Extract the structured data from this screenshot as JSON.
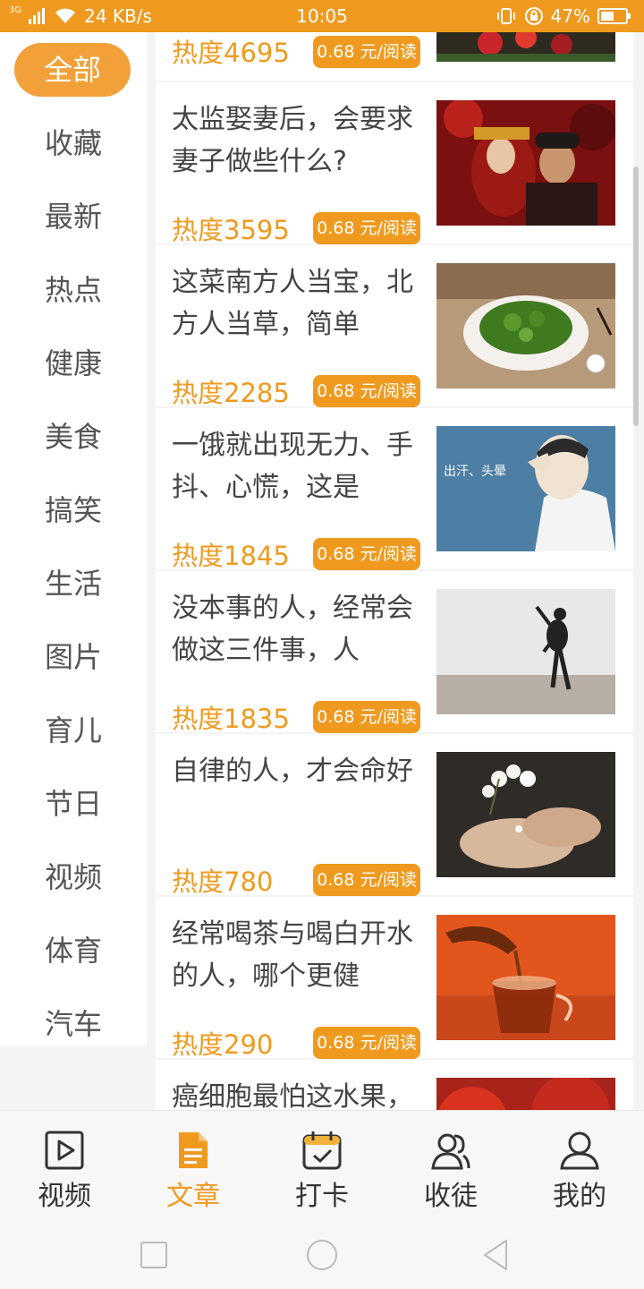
{
  "status": {
    "network": "3G",
    "speed": "24 KB/s",
    "time": "10:05",
    "battery": "47%"
  },
  "categories": [
    {
      "label": "全部",
      "active": true
    },
    {
      "label": "收藏"
    },
    {
      "label": "最新"
    },
    {
      "label": "热点"
    },
    {
      "label": "健康"
    },
    {
      "label": "美食"
    },
    {
      "label": "搞笑"
    },
    {
      "label": "生活"
    },
    {
      "label": "图片"
    },
    {
      "label": "育儿"
    },
    {
      "label": "节日"
    },
    {
      "label": "视频"
    },
    {
      "label": "体育"
    },
    {
      "label": "汽车"
    }
  ],
  "articles": [
    {
      "title": "",
      "heat": "热度4695",
      "price": "0.68 元/阅读",
      "image": "red-flowers"
    },
    {
      "title": "太监娶妻后，会要求妻子做些什么?",
      "heat": "热度3595",
      "price": "0.68 元/阅读",
      "image": "wedding-couple"
    },
    {
      "title": "这菜南方人当宝，北方人当草，简单",
      "heat": "热度2285",
      "price": "0.68 元/阅读",
      "image": "green-vegetable-plate"
    },
    {
      "title": "一饿就出现无力、手抖、心慌，这是",
      "heat": "热度1845",
      "price": "0.68 元/阅读",
      "image": "sweating-dizzy-man",
      "image_text": "出汗、头晕"
    },
    {
      "title": "没本事的人，经常会做这三件事，人",
      "heat": "热度1835",
      "price": "0.68 元/阅读",
      "image": "jumping-person"
    },
    {
      "title": "自律的人，才会命好",
      "heat": "热度780",
      "price": "0.68 元/阅读",
      "image": "hands-flowers"
    },
    {
      "title": "经常喝茶与喝白开水的人，哪个更健",
      "heat": "热度290",
      "price": "0.68 元/阅读",
      "image": "tea-pouring"
    },
    {
      "title": "癌细胞最怕这水果，",
      "heat": "",
      "price": "",
      "image": "tomatoes"
    }
  ],
  "tabs": [
    {
      "label": "视频",
      "icon": "video-play-icon"
    },
    {
      "label": "文章",
      "icon": "document-icon",
      "active": true
    },
    {
      "label": "打卡",
      "icon": "calendar-check-icon"
    },
    {
      "label": "收徒",
      "icon": "users-icon"
    },
    {
      "label": "我的",
      "icon": "user-icon"
    }
  ],
  "colors": {
    "accent": "#ef9a1f",
    "sidebar_active": "#f2a13a"
  }
}
